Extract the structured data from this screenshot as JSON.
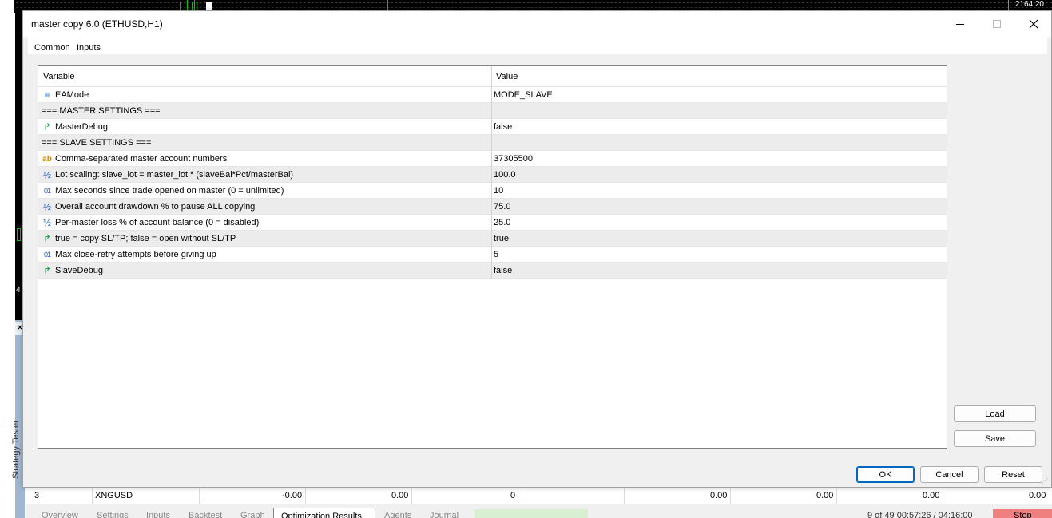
{
  "background": {
    "price_label": "2164.20",
    "left_number": "4",
    "tester_label": "Strategy Tester",
    "result_row": {
      "id": "3",
      "symbol": "XNGUSD",
      "c1": "-0.00",
      "c2": "0.00",
      "c3": "0",
      "c4": "0.00",
      "c5": "0.00",
      "c6": "0.00",
      "c7": "0.00"
    },
    "tabs": [
      "Overview",
      "Settings",
      "Inputs",
      "Backtest",
      "Graph"
    ],
    "active_tab": "Optimization Results",
    "tabs_right": [
      "Agents",
      "Journal"
    ],
    "timer": "9 of 49    00:57:26 / 04:16:00",
    "stop_label": "Stop"
  },
  "dialog": {
    "title": "master copy 6.0 (ETHUSD,H1)",
    "tabs": {
      "common": "Common",
      "inputs": "Inputs"
    },
    "grid": {
      "header_variable": "Variable",
      "header_value": "Value",
      "rows": [
        {
          "icon": "≡",
          "type": "enum",
          "variable": "EAMode",
          "value": "MODE_SLAVE"
        },
        {
          "icon": "",
          "type": "section",
          "variable": "=== MASTER SETTINGS ===",
          "value": ""
        },
        {
          "icon": "↱",
          "type": "bool",
          "variable": "MasterDebug",
          "value": "false"
        },
        {
          "icon": "",
          "type": "section",
          "variable": "=== SLAVE SETTINGS ===",
          "value": ""
        },
        {
          "icon": "ab",
          "type": "string",
          "variable": "Comma-separated master account numbers",
          "value": "37305500"
        },
        {
          "icon": "½",
          "type": "double",
          "variable": "Lot scaling: slave_lot = master_lot * (slaveBal*Pct/masterBal)",
          "value": "100.0"
        },
        {
          "icon": "01",
          "type": "int",
          "variable": "Max seconds since trade opened on master (0 = unlimited)",
          "value": "10"
        },
        {
          "icon": "½",
          "type": "double",
          "variable": "Overall account drawdown % to pause ALL copying",
          "value": "75.0"
        },
        {
          "icon": "½",
          "type": "double",
          "variable": "Per-master loss % of account balance (0 = disabled)",
          "value": "25.0"
        },
        {
          "icon": "↱",
          "type": "bool",
          "variable": "true = copy SL/TP;  false = open without SL/TP",
          "value": "true"
        },
        {
          "icon": "01",
          "type": "int",
          "variable": "Max close-retry attempts before giving up",
          "value": "5"
        },
        {
          "icon": "↱",
          "type": "bool",
          "variable": "SlaveDebug",
          "value": "false"
        }
      ]
    },
    "buttons": {
      "load": "Load",
      "save": "Save",
      "ok": "OK",
      "cancel": "Cancel",
      "reset": "Reset"
    },
    "colors": {
      "accent": "#0067c0",
      "section_bg": "#ececec",
      "bool_icon": "#18a048",
      "string_icon": "#d98a00",
      "num_icon": "#1f64c8"
    }
  }
}
